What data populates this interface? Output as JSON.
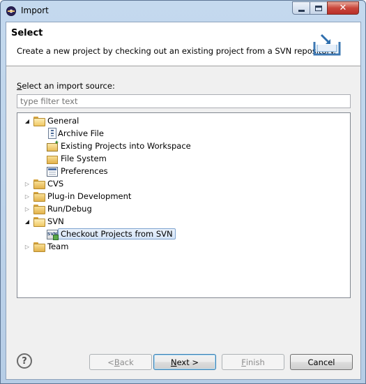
{
  "window": {
    "title": "Import",
    "controls": {
      "minimize": "minimize-icon",
      "maximize": "maximize-icon",
      "close": "close-icon"
    }
  },
  "banner": {
    "title": "Select",
    "description": "Create a new project by checking out an existing project from a SVN repository.",
    "icon": "import-wizard-icon"
  },
  "source": {
    "label_accel": "S",
    "label_rest": "elect an import source:",
    "filter_placeholder": "type filter text"
  },
  "tree": {
    "general": {
      "label": "General",
      "expanded": true
    },
    "general_children": [
      {
        "label": "Archive File",
        "icon": "archive-file-icon"
      },
      {
        "label": "Existing Projects into Workspace",
        "icon": "existing-projects-icon"
      },
      {
        "label": "File System",
        "icon": "file-system-icon"
      },
      {
        "label": "Preferences",
        "icon": "preferences-icon"
      }
    ],
    "cvs": {
      "label": "CVS",
      "expanded": false
    },
    "plugin": {
      "label": "Plug-in Development",
      "expanded": false
    },
    "rundebug": {
      "label": "Run/Debug",
      "expanded": false
    },
    "svn": {
      "label": "SVN",
      "expanded": true
    },
    "svn_children": [
      {
        "label": "Checkout Projects from SVN",
        "icon": "svn-checkout-icon",
        "selected": true
      }
    ],
    "team": {
      "label": "Team",
      "expanded": false
    }
  },
  "buttons": {
    "help_glyph": "?",
    "back_pre": "< ",
    "back_accel": "B",
    "back_rest": "ack",
    "next_accel": "N",
    "next_rest": "ext >",
    "finish_accel": "F",
    "finish_rest": "inish",
    "cancel": "Cancel"
  },
  "colors": {
    "window_frame": "#c4d9ee",
    "close_button": "#c9463b",
    "selection": "#d4e4f7"
  }
}
